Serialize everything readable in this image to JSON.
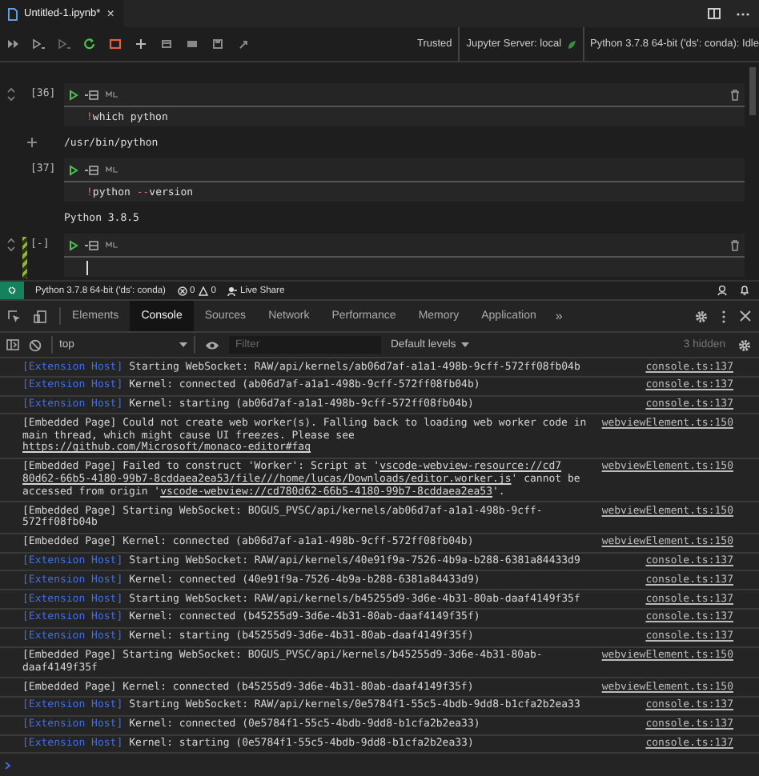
{
  "editor_tab": {
    "title": "Untitled-1.ipynb*",
    "close": "×"
  },
  "notebook_toolbar": {
    "trusted": "Trusted",
    "server": "Jupyter Server: local",
    "kernel": "Python 3.7.8 64-bit ('ds': conda): Idle"
  },
  "cells": [
    {
      "count": "[36]",
      "selected": false,
      "hovered": true,
      "code": [
        {
          "kind": "magic",
          "text": "!"
        },
        {
          "kind": "plain",
          "text": "which python"
        }
      ],
      "output": "/usr/bin/python"
    },
    {
      "count": "[37]",
      "selected": false,
      "hovered": false,
      "code": [
        {
          "kind": "magic",
          "text": "!"
        },
        {
          "kind": "plain",
          "text": "python "
        },
        {
          "kind": "magic",
          "text": "--"
        },
        {
          "kind": "plain",
          "text": "version"
        }
      ],
      "output": "Python 3.8.5"
    },
    {
      "count": "[-]",
      "selected": true,
      "hovered": true
    }
  ],
  "status_bar": {
    "interpreter": "Python 3.7.8 64-bit ('ds': conda)",
    "errors": "0",
    "warnings": "0",
    "live_share": "Live Share"
  },
  "devtools": {
    "tabs": [
      {
        "label": "Elements",
        "selected": false
      },
      {
        "label": "Console",
        "selected": true
      },
      {
        "label": "Sources",
        "selected": false
      },
      {
        "label": "Network",
        "selected": false
      },
      {
        "label": "Performance",
        "selected": false
      },
      {
        "label": "Memory",
        "selected": false
      },
      {
        "label": "Application",
        "selected": false
      }
    ],
    "more": "»",
    "context": "top",
    "filter": {
      "placeholder": "Filter"
    },
    "levels": "Default levels",
    "hidden": "3 hidden"
  },
  "console": [
    {
      "kind": "extension",
      "prefix": "[Extension Host]",
      "parts": [
        {
          "text": "Starting WebSocket: RAW/api/kernels/ab06d7af-a1a1-498b-9cff-572ff08fb04b"
        }
      ],
      "source": "console.ts:137"
    },
    {
      "kind": "extension",
      "prefix": "[Extension Host]",
      "parts": [
        {
          "text": "Kernel: connected (ab06d7af-a1a1-498b-9cff-572ff08fb04b)"
        }
      ],
      "source": "console.ts:137"
    },
    {
      "kind": "extension",
      "prefix": "[Extension Host]",
      "parts": [
        {
          "text": "Kernel: starting (ab06d7af-a1a1-498b-9cff-572ff08fb04b)"
        }
      ],
      "source": "console.ts:137"
    },
    {
      "kind": "embedded",
      "parts": [
        {
          "text": "[Embedded Page] Could not create web worker(s). Falling back to loading web worker code in main thread, which might cause UI freezes. Please see "
        },
        {
          "link": true,
          "text": "https://github.com/Microsoft/monaco-editor#faq"
        }
      ],
      "source": "webviewElement.ts:150"
    },
    {
      "kind": "embedded",
      "parts": [
        {
          "text": "[Embedded Page] Failed to construct 'Worker': Script at '"
        },
        {
          "link": true,
          "text": "vscode-webview-resource://cd7"
        },
        {
          "link": true,
          "text": "80d62-66b5-4180-99b7-8cddaea2ea53/file///home/lucas/Downloads/editor.worker.js"
        },
        {
          "text": "' cannot be accessed from origin '"
        },
        {
          "link": true,
          "text": "vscode-webview://cd780d62-66b5-4180-99b7-8cddaea2ea53"
        },
        {
          "text": "'."
        }
      ],
      "source": "webviewElement.ts:150"
    },
    {
      "kind": "embedded",
      "parts": [
        {
          "text": "[Embedded Page] Starting WebSocket: BOGUS_PVSC/api/kernels/ab06d7af-a1a1-498b-9cff-572ff08fb04b"
        }
      ],
      "source": "webviewElement.ts:150"
    },
    {
      "kind": "embedded",
      "parts": [
        {
          "text": "[Embedded Page] Kernel: connected (ab06d7af-a1a1-498b-9cff-572ff08fb04b)"
        }
      ],
      "source": "webviewElement.ts:150"
    },
    {
      "kind": "extension",
      "prefix": "[Extension Host]",
      "parts": [
        {
          "text": "Starting WebSocket: RAW/api/kernels/40e91f9a-7526-4b9a-b288-6381a84433d9"
        }
      ],
      "source": "console.ts:137"
    },
    {
      "kind": "extension",
      "prefix": "[Extension Host]",
      "parts": [
        {
          "text": "Kernel: connected (40e91f9a-7526-4b9a-b288-6381a84433d9)"
        }
      ],
      "source": "console.ts:137"
    },
    {
      "kind": "extension",
      "prefix": "[Extension Host]",
      "parts": [
        {
          "text": "Starting WebSocket: RAW/api/kernels/b45255d9-3d6e-4b31-80ab-daaf4149f35f"
        }
      ],
      "source": "console.ts:137"
    },
    {
      "kind": "extension",
      "prefix": "[Extension Host]",
      "parts": [
        {
          "text": "Kernel: connected (b45255d9-3d6e-4b31-80ab-daaf4149f35f)"
        }
      ],
      "source": "console.ts:137"
    },
    {
      "kind": "extension",
      "prefix": "[Extension Host]",
      "parts": [
        {
          "text": "Kernel: starting (b45255d9-3d6e-4b31-80ab-daaf4149f35f)"
        }
      ],
      "source": "console.ts:137"
    },
    {
      "kind": "embedded",
      "parts": [
        {
          "text": "[Embedded Page] Starting WebSocket: BOGUS_PVSC/api/kernels/b45255d9-3d6e-4b31-80ab-daaf4149f35f"
        }
      ],
      "source": "webviewElement.ts:150"
    },
    {
      "kind": "embedded",
      "parts": [
        {
          "text": "[Embedded Page] Kernel: connected (b45255d9-3d6e-4b31-80ab-daaf4149f35f)"
        }
      ],
      "source": "webviewElement.ts:150"
    },
    {
      "kind": "extension",
      "prefix": "[Extension Host]",
      "parts": [
        {
          "text": "Starting WebSocket: RAW/api/kernels/0e5784f1-55c5-4bdb-9dd8-b1cfa2b2ea33"
        }
      ],
      "source": "console.ts:137"
    },
    {
      "kind": "extension",
      "prefix": "[Extension Host]",
      "parts": [
        {
          "text": "Kernel: connected (0e5784f1-55c5-4bdb-9dd8-b1cfa2b2ea33)"
        }
      ],
      "source": "console.ts:137"
    },
    {
      "kind": "extension",
      "prefix": "[Extension Host]",
      "parts": [
        {
          "text": "Kernel: starting (0e5784f1-55c5-4bdb-9dd8-b1cfa2b2ea33)"
        }
      ],
      "source": "console.ts:137"
    }
  ]
}
